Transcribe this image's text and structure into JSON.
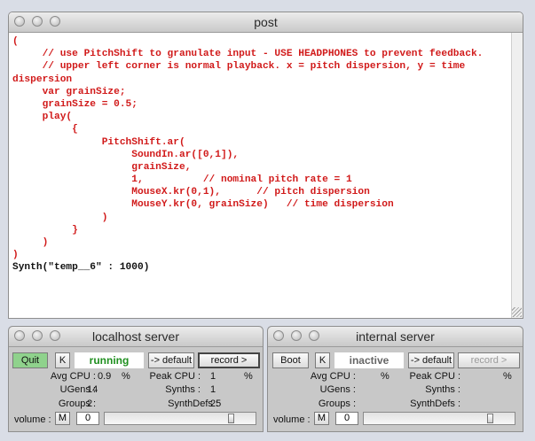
{
  "post": {
    "title": "post",
    "lines": [
      "(",
      "     // use PitchShift to granulate input - USE HEADPHONES to prevent feedback.",
      "     // upper left corner is normal playback. x = pitch dispersion, y = time",
      "dispersion",
      "     var grainSize;",
      "     grainSize = 0.5;",
      "     play(",
      "          {",
      "               PitchShift.ar(",
      "                    SoundIn.ar([0,1]),",
      "                    grainSize,",
      "                    1,          // nominal pitch rate = 1",
      "                    MouseX.kr(0,1),      // pitch dispersion",
      "                    MouseY.kr(0, grainSize)   // time dispersion",
      "               )",
      "          }",
      "     )",
      ")"
    ],
    "result_line": "Synth(\"temp__6\" : 1000)"
  },
  "colors": {
    "code": "#d11a1a",
    "running": "#1f8f1f",
    "inactive": "#666666"
  },
  "local": {
    "title": "localhost server",
    "quit_label": "Quit",
    "k_label": "K",
    "status": "running",
    "default_label": "-> default",
    "record_label": "record >",
    "avg_cpu_label": "Avg CPU :",
    "avg_cpu_value": "0.9",
    "avg_cpu_unit": "%",
    "peak_cpu_label": "Peak CPU :",
    "peak_cpu_value": "1",
    "peak_cpu_unit": "%",
    "ugens_label": "UGens :",
    "ugens_value": "14",
    "synths_label": "Synths :",
    "synths_value": "1",
    "groups_label": "Groups :",
    "groups_value": "2",
    "synthdefs_label": "SynthDefs :",
    "synthdefs_value": "25",
    "volume_label": "volume :",
    "m_label": "M",
    "volume_value": "0",
    "volume_level": 0.85
  },
  "internal": {
    "title": "internal server",
    "boot_label": "Boot",
    "k_label": "K",
    "status": "inactive",
    "default_label": "-> default",
    "record_label": "record >",
    "avg_cpu_label": "Avg CPU :",
    "avg_cpu_unit": "%",
    "peak_cpu_label": "Peak CPU :",
    "peak_cpu_unit": "%",
    "ugens_label": "UGens :",
    "synths_label": "Synths :",
    "groups_label": "Groups :",
    "synthdefs_label": "SynthDefs :",
    "volume_label": "volume :",
    "m_label": "M",
    "volume_value": "0",
    "volume_level": 0.85
  }
}
